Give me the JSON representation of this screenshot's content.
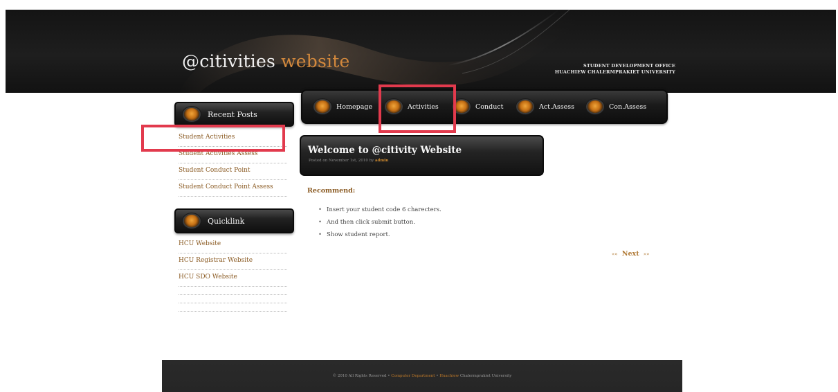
{
  "header": {
    "title_main": "@citivities ",
    "title_accent": "website",
    "org_line1": "STUDENT DEVELOPMENT OFFICE",
    "org_line2": "HUACHIEW CHALERMPRAKIET UNIVERSITY"
  },
  "nav": {
    "items": [
      {
        "label": "Homepage",
        "icon": "orb-icon"
      },
      {
        "label": "Activities",
        "icon": "orb-icon"
      },
      {
        "label": "Conduct",
        "icon": "orb-icon"
      },
      {
        "label": "Act.Assess",
        "icon": "orb-icon"
      },
      {
        "label": "Con.Assess",
        "icon": "orb-icon"
      }
    ]
  },
  "sidebar": {
    "recent_title": "Recent Posts",
    "recent_links": [
      "Student Activities",
      "Student Activities Assess",
      "Student Conduct Point",
      "Student Conduct Point Assess"
    ],
    "quick_title": "Quicklink",
    "quick_links": [
      "HCU Website",
      "HCU Registrar Website",
      "HCU SDO Website"
    ]
  },
  "main": {
    "welcome_title": "Welcome to @citivity Website",
    "welcome_meta_prefix": "Posted on November 1st, 2010 by ",
    "welcome_author": "admin",
    "recommend_heading": "Recommend:",
    "recommend_items": [
      "Insert your student code 6 charecters.",
      "And then click submit button.",
      "Show student report."
    ],
    "pager_left": "«« ",
    "pager_next": "Next",
    "pager_right": " »»"
  },
  "footer": {
    "prefix": "© 2010 All Rights Reserved • ",
    "dept": "Computer Department",
    "sep": " • ",
    "uni_hl": "Huachiew",
    "uni_rest": " Chalermprakiet University"
  },
  "colors": {
    "accent": "#d2883c",
    "link": "#8a5a22",
    "highlight": "#e23a4d"
  }
}
